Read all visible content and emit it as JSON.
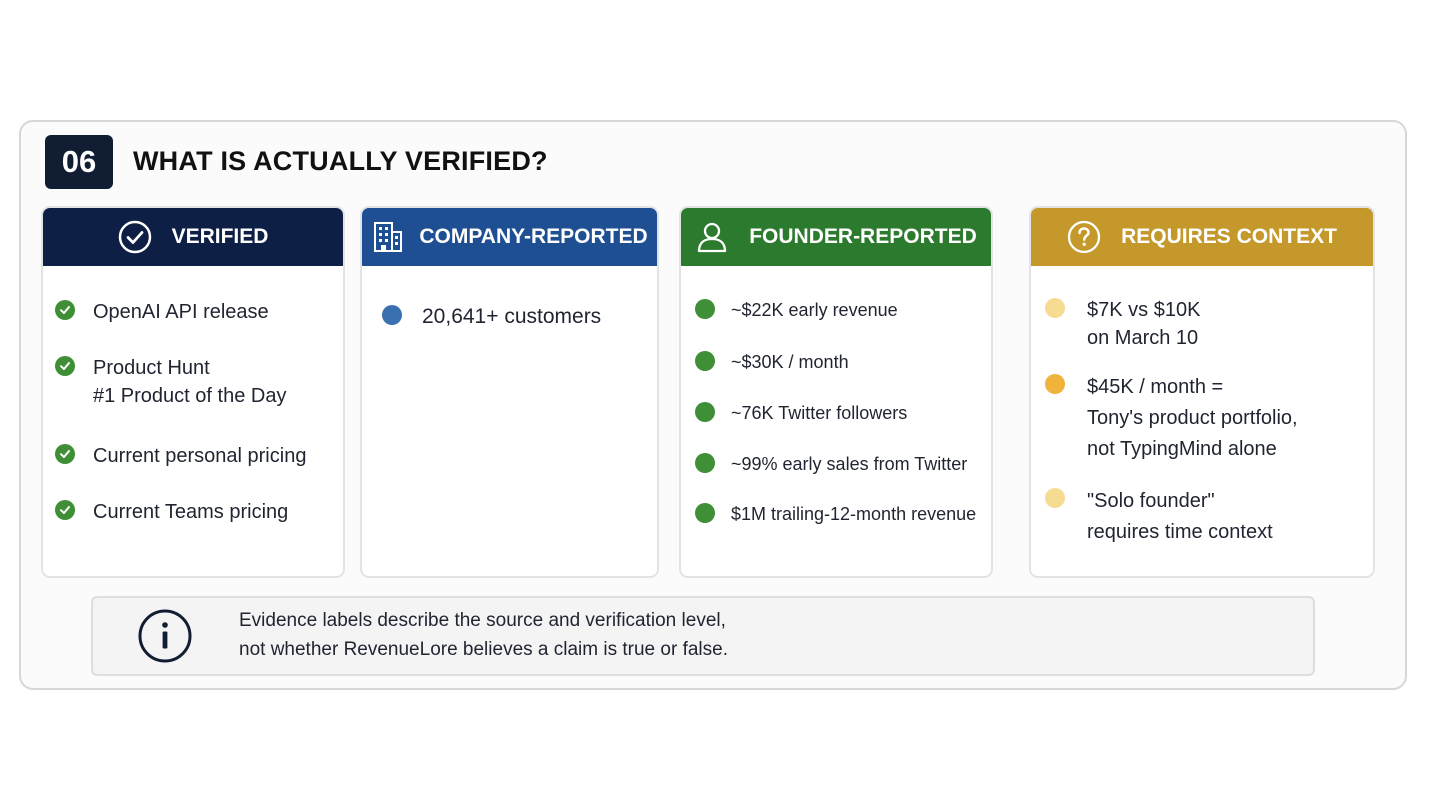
{
  "section": {
    "number": "06",
    "title": "WHAT IS ACTUALLY VERIFIED?"
  },
  "columns": [
    {
      "heading": "VERIFIED",
      "icon": "check-circle-icon",
      "color": "#0d1f45",
      "bullet_color": "#3e8f36",
      "items": [
        "OpenAI API release",
        "Product Hunt\n#1 Product of the Day",
        "Current personal pricing",
        "Current Teams pricing"
      ]
    },
    {
      "heading": "COMPANY-REPORTED",
      "icon": "building-icon",
      "color": "#1e4f93",
      "bullet_color": "#3a6fb0",
      "items": [
        "20,641+ customers"
      ]
    },
    {
      "heading": "FOUNDER-REPORTED",
      "icon": "person-icon",
      "color": "#2b7a2e",
      "bullet_color": "#3e8f36",
      "items": [
        "~$22K early revenue",
        "~$30K / month",
        "~76K Twitter followers",
        "~99% early sales from Twitter",
        "$1M trailing-12-month revenue"
      ]
    },
    {
      "heading": "REQUIRES CONTEXT",
      "icon": "question-circle-icon",
      "color": "#c4982a",
      "bullet_colors": [
        "#f6dc93",
        "#f0b43c",
        "#f6dc93"
      ],
      "items": [
        "$7K vs $10K\non March 10",
        "$45K / month =\nTony's product portfolio,\nnot TypingMind alone",
        "\"Solo founder\"\nrequires time context"
      ]
    }
  ],
  "note": {
    "icon": "info-icon",
    "line1": "Evidence labels describe the source and verification level,",
    "line2": "not whether RevenueLore believes a claim is true or false."
  }
}
